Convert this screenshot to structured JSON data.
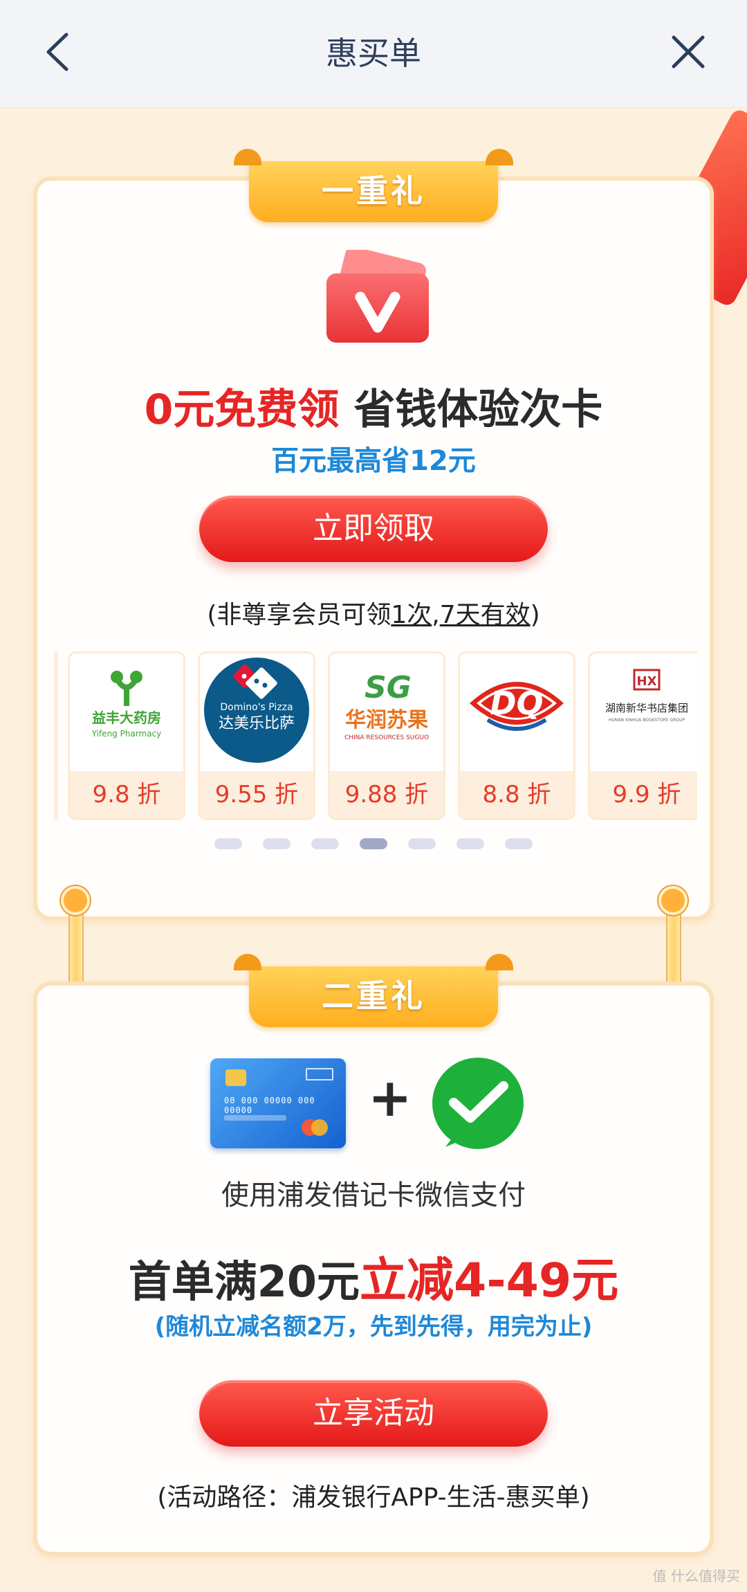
{
  "header": {
    "title": "惠买单"
  },
  "gift1": {
    "ribbon": "一重礼",
    "promo_red": "0元免费领",
    "promo_dark": "省钱体验次卡",
    "promo_sub": "百元最高省12元",
    "button": "立即领取",
    "note_prefix": "(非尊享会员可领",
    "note_u1": "1次",
    "note_mid": ",",
    "note_u2": "7天有效",
    "note_suffix": ")",
    "merchants": [
      {
        "name_cn": "益丰大药房",
        "name_en": "Yifeng Pharmacy",
        "discount": "9.8 折",
        "color": "#3fa535"
      },
      {
        "name_cn": "达美乐比萨",
        "name_en": "Domino's Pizza",
        "discount": "9.55 折",
        "color": "#0b5a8a"
      },
      {
        "name_cn": "华润苏果",
        "name_en": "CHINA RESOURCES SUGUO",
        "discount": "9.88 折",
        "color": "#e8731d"
      },
      {
        "name_cn": "DQ",
        "name_en": "",
        "discount": "8.8 折",
        "color": "#e1251b"
      },
      {
        "name_cn": "湖南新华书店集团",
        "name_en": "HUNAN XINHUA BOOKSTORE GROUP",
        "discount": "9.9 折",
        "color": "#c2272d"
      }
    ],
    "logo_marks": {
      "domino_brand": "Domino's Pizza",
      "sg_mark": "SG",
      "hx_mark": "HX"
    },
    "dots_active_index": 3
  },
  "gift2": {
    "ribbon": "二重礼",
    "card_number": "00 000 00000 000 00000",
    "plus": "+",
    "pay_text": "使用浦发借记卡微信支付",
    "offer_dark": "首单满20元",
    "offer_red": "立减4-49元",
    "offer_sub": "(随机立减名额2万，先到先得，用完为止)",
    "button": "立享活动",
    "note": "(活动路径：浦发银行APP-生活-惠买单)"
  },
  "watermark": "值 什么值得买"
}
